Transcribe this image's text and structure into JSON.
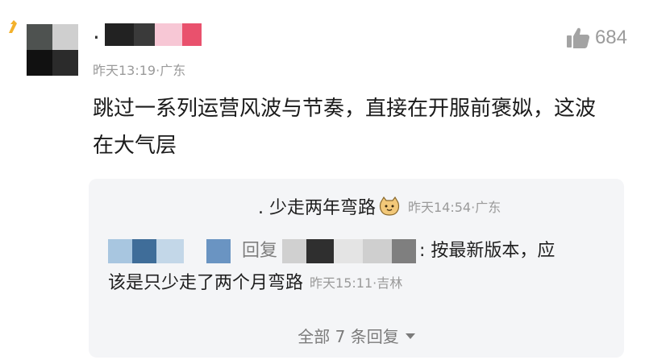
{
  "comment": {
    "username_visible": ".",
    "meta": "昨天13:19·广东",
    "likes": "684",
    "text": "跳过一系列运营风波与节奏，直接在开服前褒姒，这波在大气层"
  },
  "replies": {
    "reply1": {
      "name": ". 少走两年弯路",
      "time": "昨天14:54·广东"
    },
    "reply2": {
      "reply_word": "回复",
      "text_line1": ": 按最新版本，应",
      "text_line2": "该是只少走了两个月弯路",
      "time": "昨天15:11·吉林"
    },
    "more_label": "全部 7 条回复"
  },
  "colors": {
    "meta_gray": "#9a9a9a",
    "reply_bg": "#f4f5f7"
  }
}
